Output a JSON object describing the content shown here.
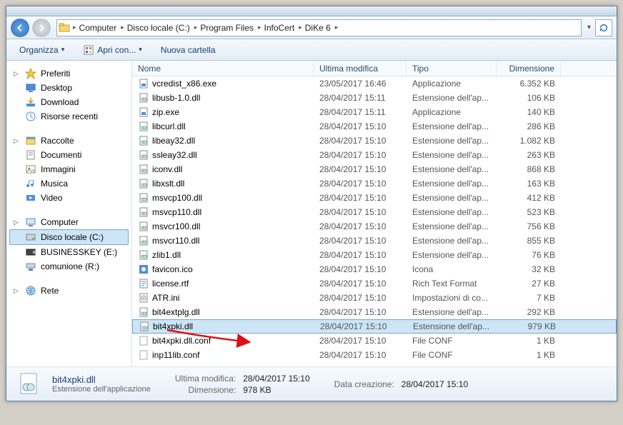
{
  "breadcrumb": [
    "Computer",
    "Disco locale (C:)",
    "Program Files",
    "InfoCert",
    "DiKe 6"
  ],
  "toolbar": {
    "organize": "Organizza",
    "openwith": "Apri con...",
    "newfolder": "Nuova cartella"
  },
  "columns": {
    "name": "Nome",
    "modified": "Ultima modifica",
    "type": "Tipo",
    "size": "Dimensione"
  },
  "nav": {
    "favorites": {
      "label": "Preferiti",
      "items": [
        "Desktop",
        "Download",
        "Risorse recenti"
      ]
    },
    "libraries": {
      "label": "Raccolte",
      "items": [
        "Documenti",
        "Immagini",
        "Musica",
        "Video"
      ]
    },
    "computer": {
      "label": "Computer",
      "items": [
        "Disco locale (C:)",
        "BUSINESSKEY (E:)",
        "comunione (R:)"
      ]
    },
    "network": {
      "label": "Rete"
    }
  },
  "files": [
    {
      "name": "vcredist_x86.exe",
      "icon": "exe",
      "mod": "23/05/2017 16:46",
      "type": "Applicazione",
      "size": "6.352 KB"
    },
    {
      "name": "libusb-1.0.dll",
      "icon": "dll",
      "mod": "28/04/2017 15:11",
      "type": "Estensione dell'ap...",
      "size": "106 KB"
    },
    {
      "name": "zip.exe",
      "icon": "exe",
      "mod": "28/04/2017 15:11",
      "type": "Applicazione",
      "size": "140 KB"
    },
    {
      "name": "libcurl.dll",
      "icon": "dll",
      "mod": "28/04/2017 15:10",
      "type": "Estensione dell'ap...",
      "size": "286 KB"
    },
    {
      "name": "libeay32.dll",
      "icon": "dll",
      "mod": "28/04/2017 15:10",
      "type": "Estensione dell'ap...",
      "size": "1.082 KB"
    },
    {
      "name": "ssleay32.dll",
      "icon": "dll",
      "mod": "28/04/2017 15:10",
      "type": "Estensione dell'ap...",
      "size": "263 KB"
    },
    {
      "name": "iconv.dll",
      "icon": "dll",
      "mod": "28/04/2017 15:10",
      "type": "Estensione dell'ap...",
      "size": "868 KB"
    },
    {
      "name": "libxslt.dll",
      "icon": "dll",
      "mod": "28/04/2017 15:10",
      "type": "Estensione dell'ap...",
      "size": "163 KB"
    },
    {
      "name": "msvcp100.dll",
      "icon": "dll",
      "mod": "28/04/2017 15:10",
      "type": "Estensione dell'ap...",
      "size": "412 KB"
    },
    {
      "name": "msvcp110.dll",
      "icon": "dll",
      "mod": "28/04/2017 15:10",
      "type": "Estensione dell'ap...",
      "size": "523 KB"
    },
    {
      "name": "msvcr100.dll",
      "icon": "dll",
      "mod": "28/04/2017 15:10",
      "type": "Estensione dell'ap...",
      "size": "756 KB"
    },
    {
      "name": "msvcr110.dll",
      "icon": "dll",
      "mod": "28/04/2017 15:10",
      "type": "Estensione dell'ap...",
      "size": "855 KB"
    },
    {
      "name": "zlib1.dll",
      "icon": "dll",
      "mod": "28/04/2017 15:10",
      "type": "Estensione dell'ap...",
      "size": "76 KB"
    },
    {
      "name": "favicon.ico",
      "icon": "ico",
      "mod": "28/04/2017 15:10",
      "type": "Icona",
      "size": "32 KB"
    },
    {
      "name": "license.rtf",
      "icon": "rtf",
      "mod": "28/04/2017 15:10",
      "type": "Rich Text Format",
      "size": "27 KB"
    },
    {
      "name": "ATR.ini",
      "icon": "ini",
      "mod": "28/04/2017 15:10",
      "type": "Impostazioni di co...",
      "size": "7 KB"
    },
    {
      "name": "bit4extplg.dll",
      "icon": "dll",
      "mod": "28/04/2017 15:10",
      "type": "Estensione dell'ap...",
      "size": "292 KB"
    },
    {
      "name": "bit4xpki.dll",
      "icon": "dll",
      "mod": "28/04/2017 15:10",
      "type": "Estensione dell'ap...",
      "size": "979 KB",
      "selected": true
    },
    {
      "name": "bit4xpki.dll.conf",
      "icon": "conf",
      "mod": "28/04/2017 15:10",
      "type": "File CONF",
      "size": "1 KB"
    },
    {
      "name": "inp11lib.conf",
      "icon": "conf",
      "mod": "28/04/2017 15:10",
      "type": "File CONF",
      "size": "1 KB"
    }
  ],
  "details": {
    "name": "bit4xpki.dll",
    "type": "Estensione dell'applicazione",
    "mod_label": "Ultima modifica:",
    "mod": "28/04/2017 15:10",
    "size_label": "Dimensione:",
    "size": "978 KB",
    "created_label": "Data creazione:",
    "created": "28/04/2017 15:10"
  }
}
